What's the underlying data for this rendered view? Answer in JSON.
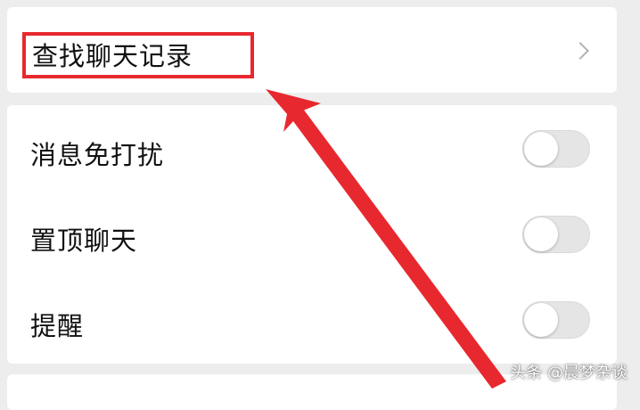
{
  "search": {
    "label": "查找聊天记录"
  },
  "settings": [
    {
      "label": "消息免打扰",
      "on": false
    },
    {
      "label": "置顶聊天",
      "on": false
    },
    {
      "label": "提醒",
      "on": false
    }
  ],
  "annotation": {
    "highlight_color": "#e8282f",
    "arrow_color": "#e8282f"
  },
  "watermark": {
    "text": "头条 @晨梦杂谈"
  },
  "icons": {
    "chevron": "chevron-right-icon"
  }
}
